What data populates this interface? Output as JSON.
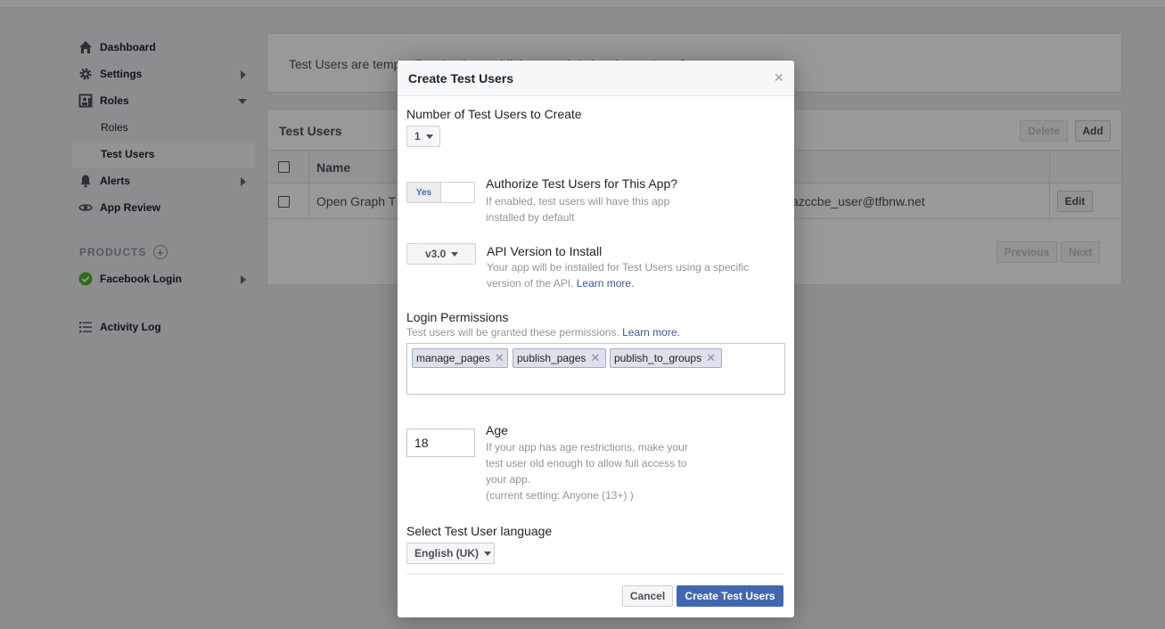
{
  "sidebar": {
    "dashboard": "Dashboard",
    "settings": "Settings",
    "roles": "Roles",
    "roles_sub": "Roles",
    "test_users": "Test Users",
    "alerts": "Alerts",
    "app_review": "App Review",
    "products": "PRODUCTS",
    "facebook_login": "Facebook Login",
    "activity_log": "Activity Log"
  },
  "info": {
    "text": "Test Users are temp... Facebook ... publish ... used during the testing of your app.",
    "help": "[?]"
  },
  "users": {
    "title": "Test Users",
    "delete": "Delete",
    "add": "Add",
    "col_name": "Name",
    "row_name": "Open Graph T",
    "row_email": "azccbe_user@tfbnw.net",
    "edit": "Edit",
    "previous": "Previous",
    "next": "Next"
  },
  "dialog": {
    "title": "Create Test Users",
    "close": "×",
    "num_label": "Number of Test Users to Create",
    "num_value": "1",
    "toggle_yes": "Yes",
    "auth_title": "Authorize Test Users for This App?",
    "auth_hint_1": "If enabled, test users will have this app",
    "auth_hint_2": "installed by default",
    "api_value": "v3.0",
    "api_title": "API Version to Install",
    "api_hint_1": "Your app will be installed for Test Users using a specific",
    "api_hint_2": "version of the API.",
    "learn_more": "Learn more.",
    "perm_label": "Login Permissions",
    "perm_hint": "Test users will be granted these permissions.",
    "perm_tags": [
      "manage_pages",
      "publish_pages",
      "publish_to_groups"
    ],
    "age_value": "18",
    "age_title": "Age",
    "age_hint_1": "If your app has age restrictions, make your",
    "age_hint_2": "test user old enough to allow full access to",
    "age_hint_3": "your app.",
    "age_hint_4": "(current setting: Anyone (13+) )",
    "lang_label": "Select Test User language",
    "lang_value": "English (UK)",
    "cancel": "Cancel",
    "create": "Create Test Users"
  },
  "colors": {
    "accent": "#4267b2",
    "link": "#365899",
    "success": "#42b72a"
  },
  "icons": {
    "dashboard": "home-icon",
    "settings": "gear-icon",
    "roles": "roles-icon",
    "alerts": "bell-icon",
    "app_review": "eye-icon",
    "products_add": "plus-circle-icon",
    "facebook_login": "check-circle-icon",
    "activity_log": "list-icon"
  }
}
